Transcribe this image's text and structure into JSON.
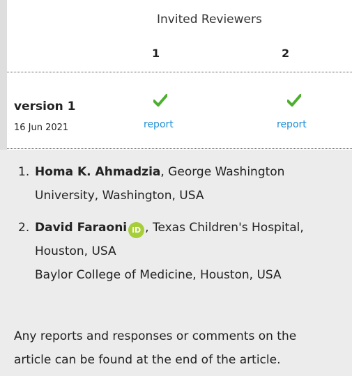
{
  "header": {
    "title": "Invited Reviewers",
    "columns": [
      "1",
      "2"
    ]
  },
  "version": {
    "label": "version 1",
    "date": "16 Jun 2021",
    "reports": [
      {
        "label": "report",
        "status": "approved"
      },
      {
        "label": "report",
        "status": "approved"
      }
    ]
  },
  "reviewers": [
    {
      "number": "1.",
      "name": "Homa K. Ahmadzia",
      "affiliation_line1": ", George Washington",
      "affiliation_line2": "University, Washington, USA"
    },
    {
      "number": "2.",
      "name": "David Faraoni",
      "orcid_label": "iD",
      "affiliation_line1": ", Texas Children's Hospital,",
      "affiliation_line2": "Houston, USA",
      "affiliation_line3": "Baylor College of Medicine, Houston, USA"
    }
  ],
  "footer": {
    "line1": "Any reports and responses or comments on the",
    "line2": "article can be found at the end of the article."
  },
  "colors": {
    "link": "#1d8fd6",
    "check": "#4caf2f",
    "orcid": "#a6ce39"
  }
}
